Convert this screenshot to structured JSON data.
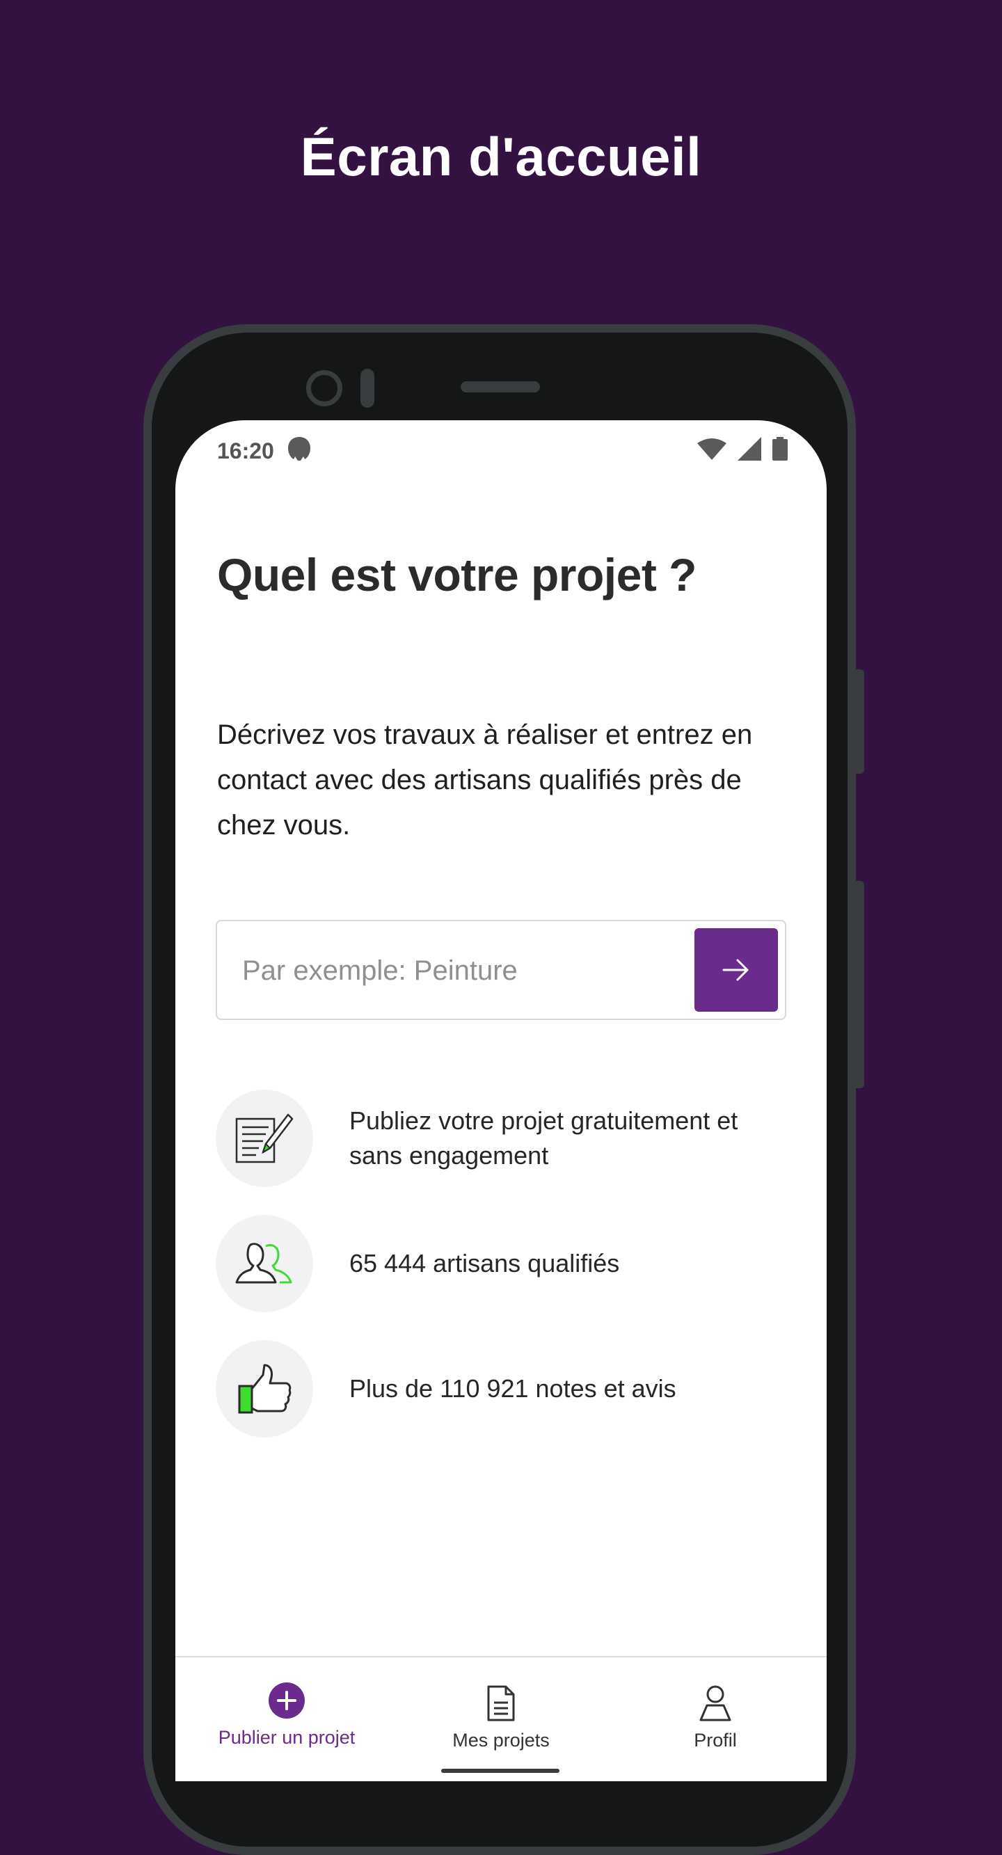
{
  "promo": {
    "title": "Écran d'accueil"
  },
  "status_bar": {
    "time": "16:20"
  },
  "main": {
    "heading": "Quel est votre projet ?",
    "description": "Décrivez vos travaux à réaliser et entrez en contact avec des artisans qualifiés près de chez vous.",
    "search": {
      "placeholder": "Par exemple: Peinture",
      "value": ""
    },
    "features": [
      {
        "icon": "document-pen-icon",
        "text": "Publiez votre projet gratuitement et sans engagement"
      },
      {
        "icon": "people-icon",
        "text": "65 444 artisans qualifiés"
      },
      {
        "icon": "thumbs-up-icon",
        "text": "Plus de 110 921 notes et avis"
      }
    ]
  },
  "bottom_nav": {
    "items": [
      {
        "label": "Publier un projet",
        "icon": "plus-circle-icon",
        "active": true
      },
      {
        "label": "Mes projets",
        "icon": "document-icon",
        "active": false
      },
      {
        "label": "Profil",
        "icon": "user-icon",
        "active": false
      }
    ]
  },
  "colors": {
    "background": "#331241",
    "accent": "#6b2a8e",
    "highlight_green": "#3ddc2f"
  }
}
